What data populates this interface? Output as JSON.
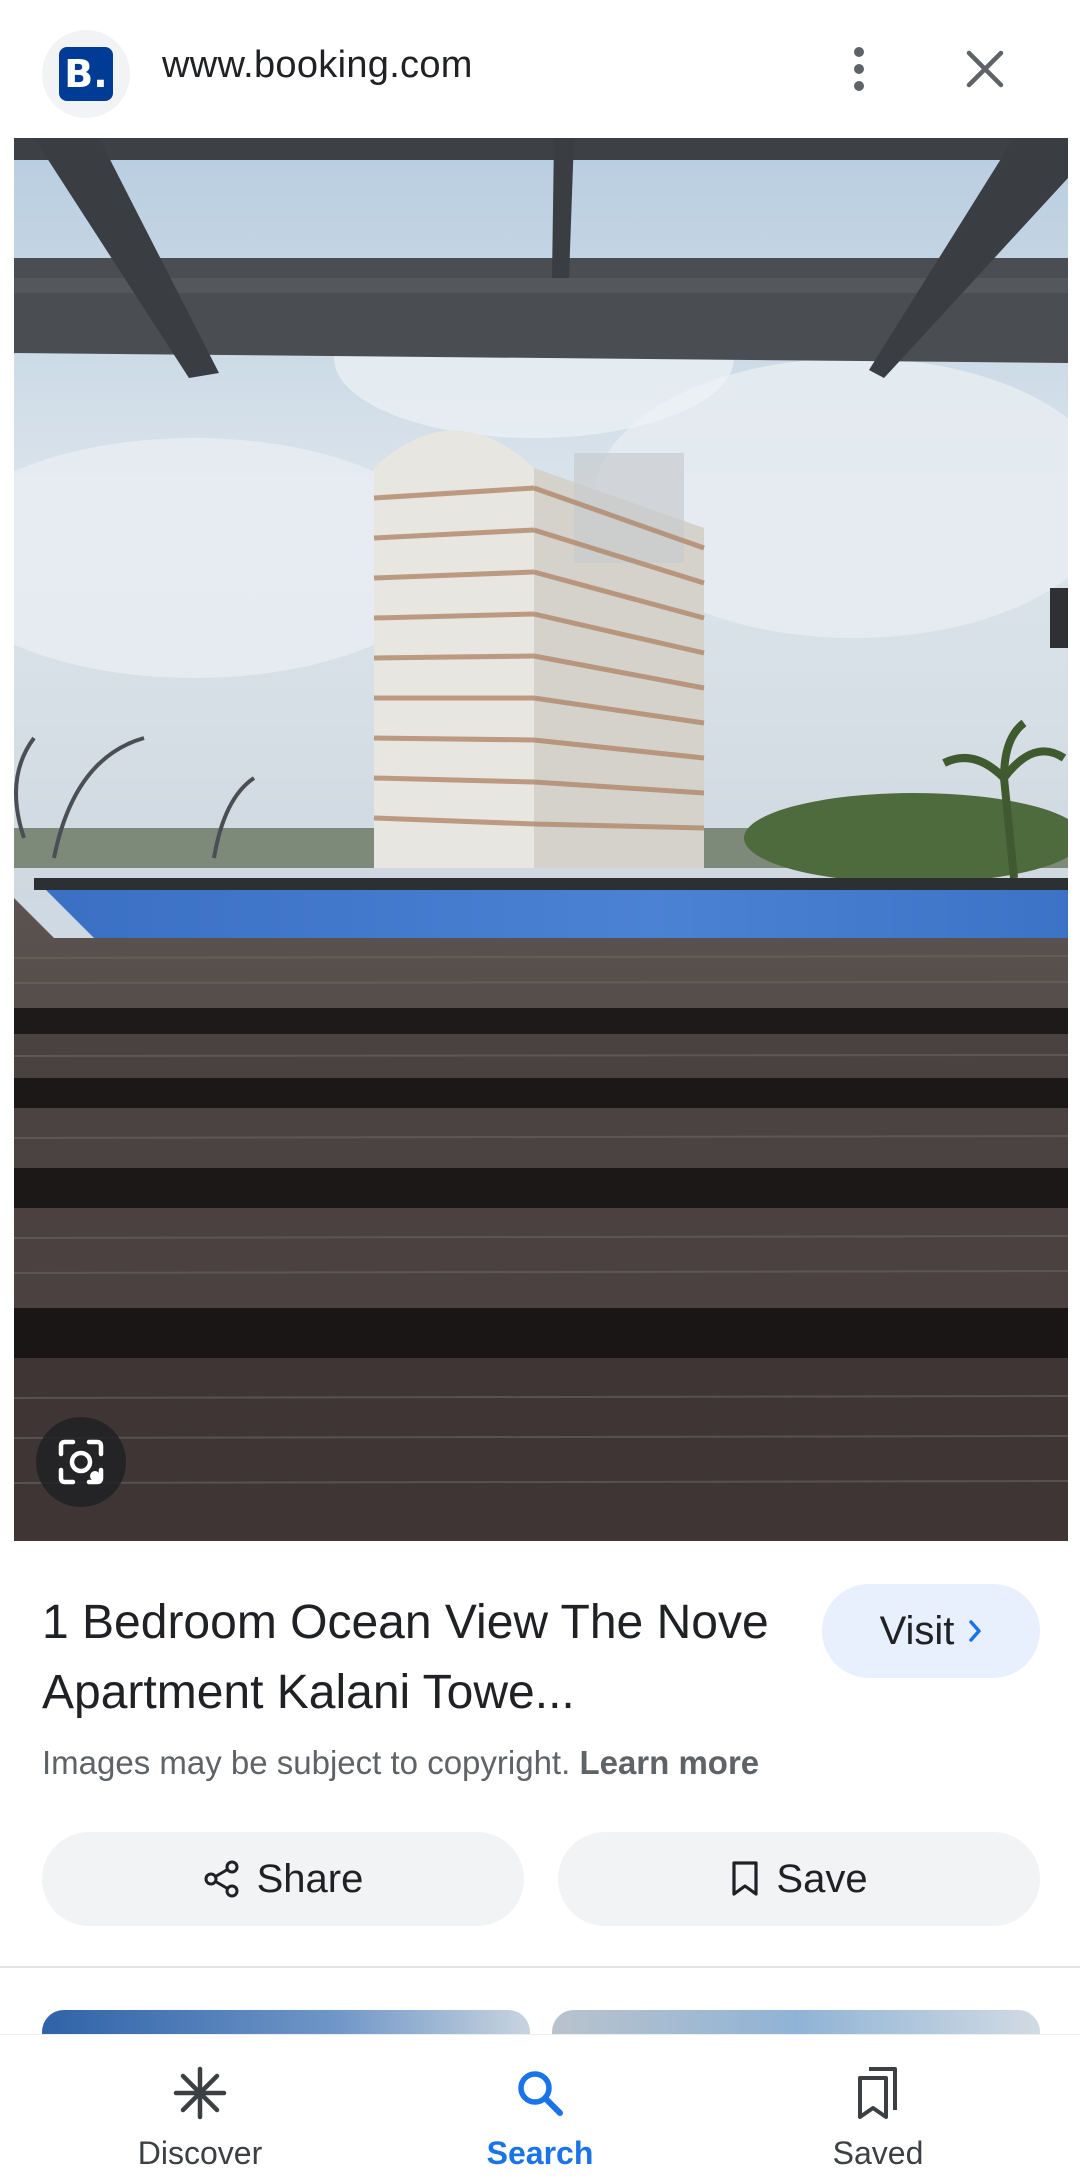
{
  "header": {
    "site_logo_text": "B.",
    "site_url": "www.booking.com",
    "more_icon": "more-vert-icon",
    "close_icon": "close-icon"
  },
  "image": {
    "lens_icon": "google-lens-icon"
  },
  "result": {
    "title": "1 Bedroom Ocean View The Nove Apartment Kalani Towe...",
    "visit_label": "Visit",
    "copyright_text": "Images may be subject to copyright.",
    "learn_more": "Learn more",
    "share_label": "Share",
    "save_label": "Save"
  },
  "bottom_nav": {
    "items": [
      {
        "label": "Discover",
        "icon": "asterisk-icon",
        "active": false
      },
      {
        "label": "Search",
        "icon": "search-icon",
        "active": true
      },
      {
        "label": "Saved",
        "icon": "bookmarks-icon",
        "active": false
      }
    ]
  },
  "colors": {
    "accent": "#1a73e8",
    "booking_brand": "#003b95",
    "visit_bg": "#e8f0fe",
    "pill_bg": "#f1f3f4"
  }
}
